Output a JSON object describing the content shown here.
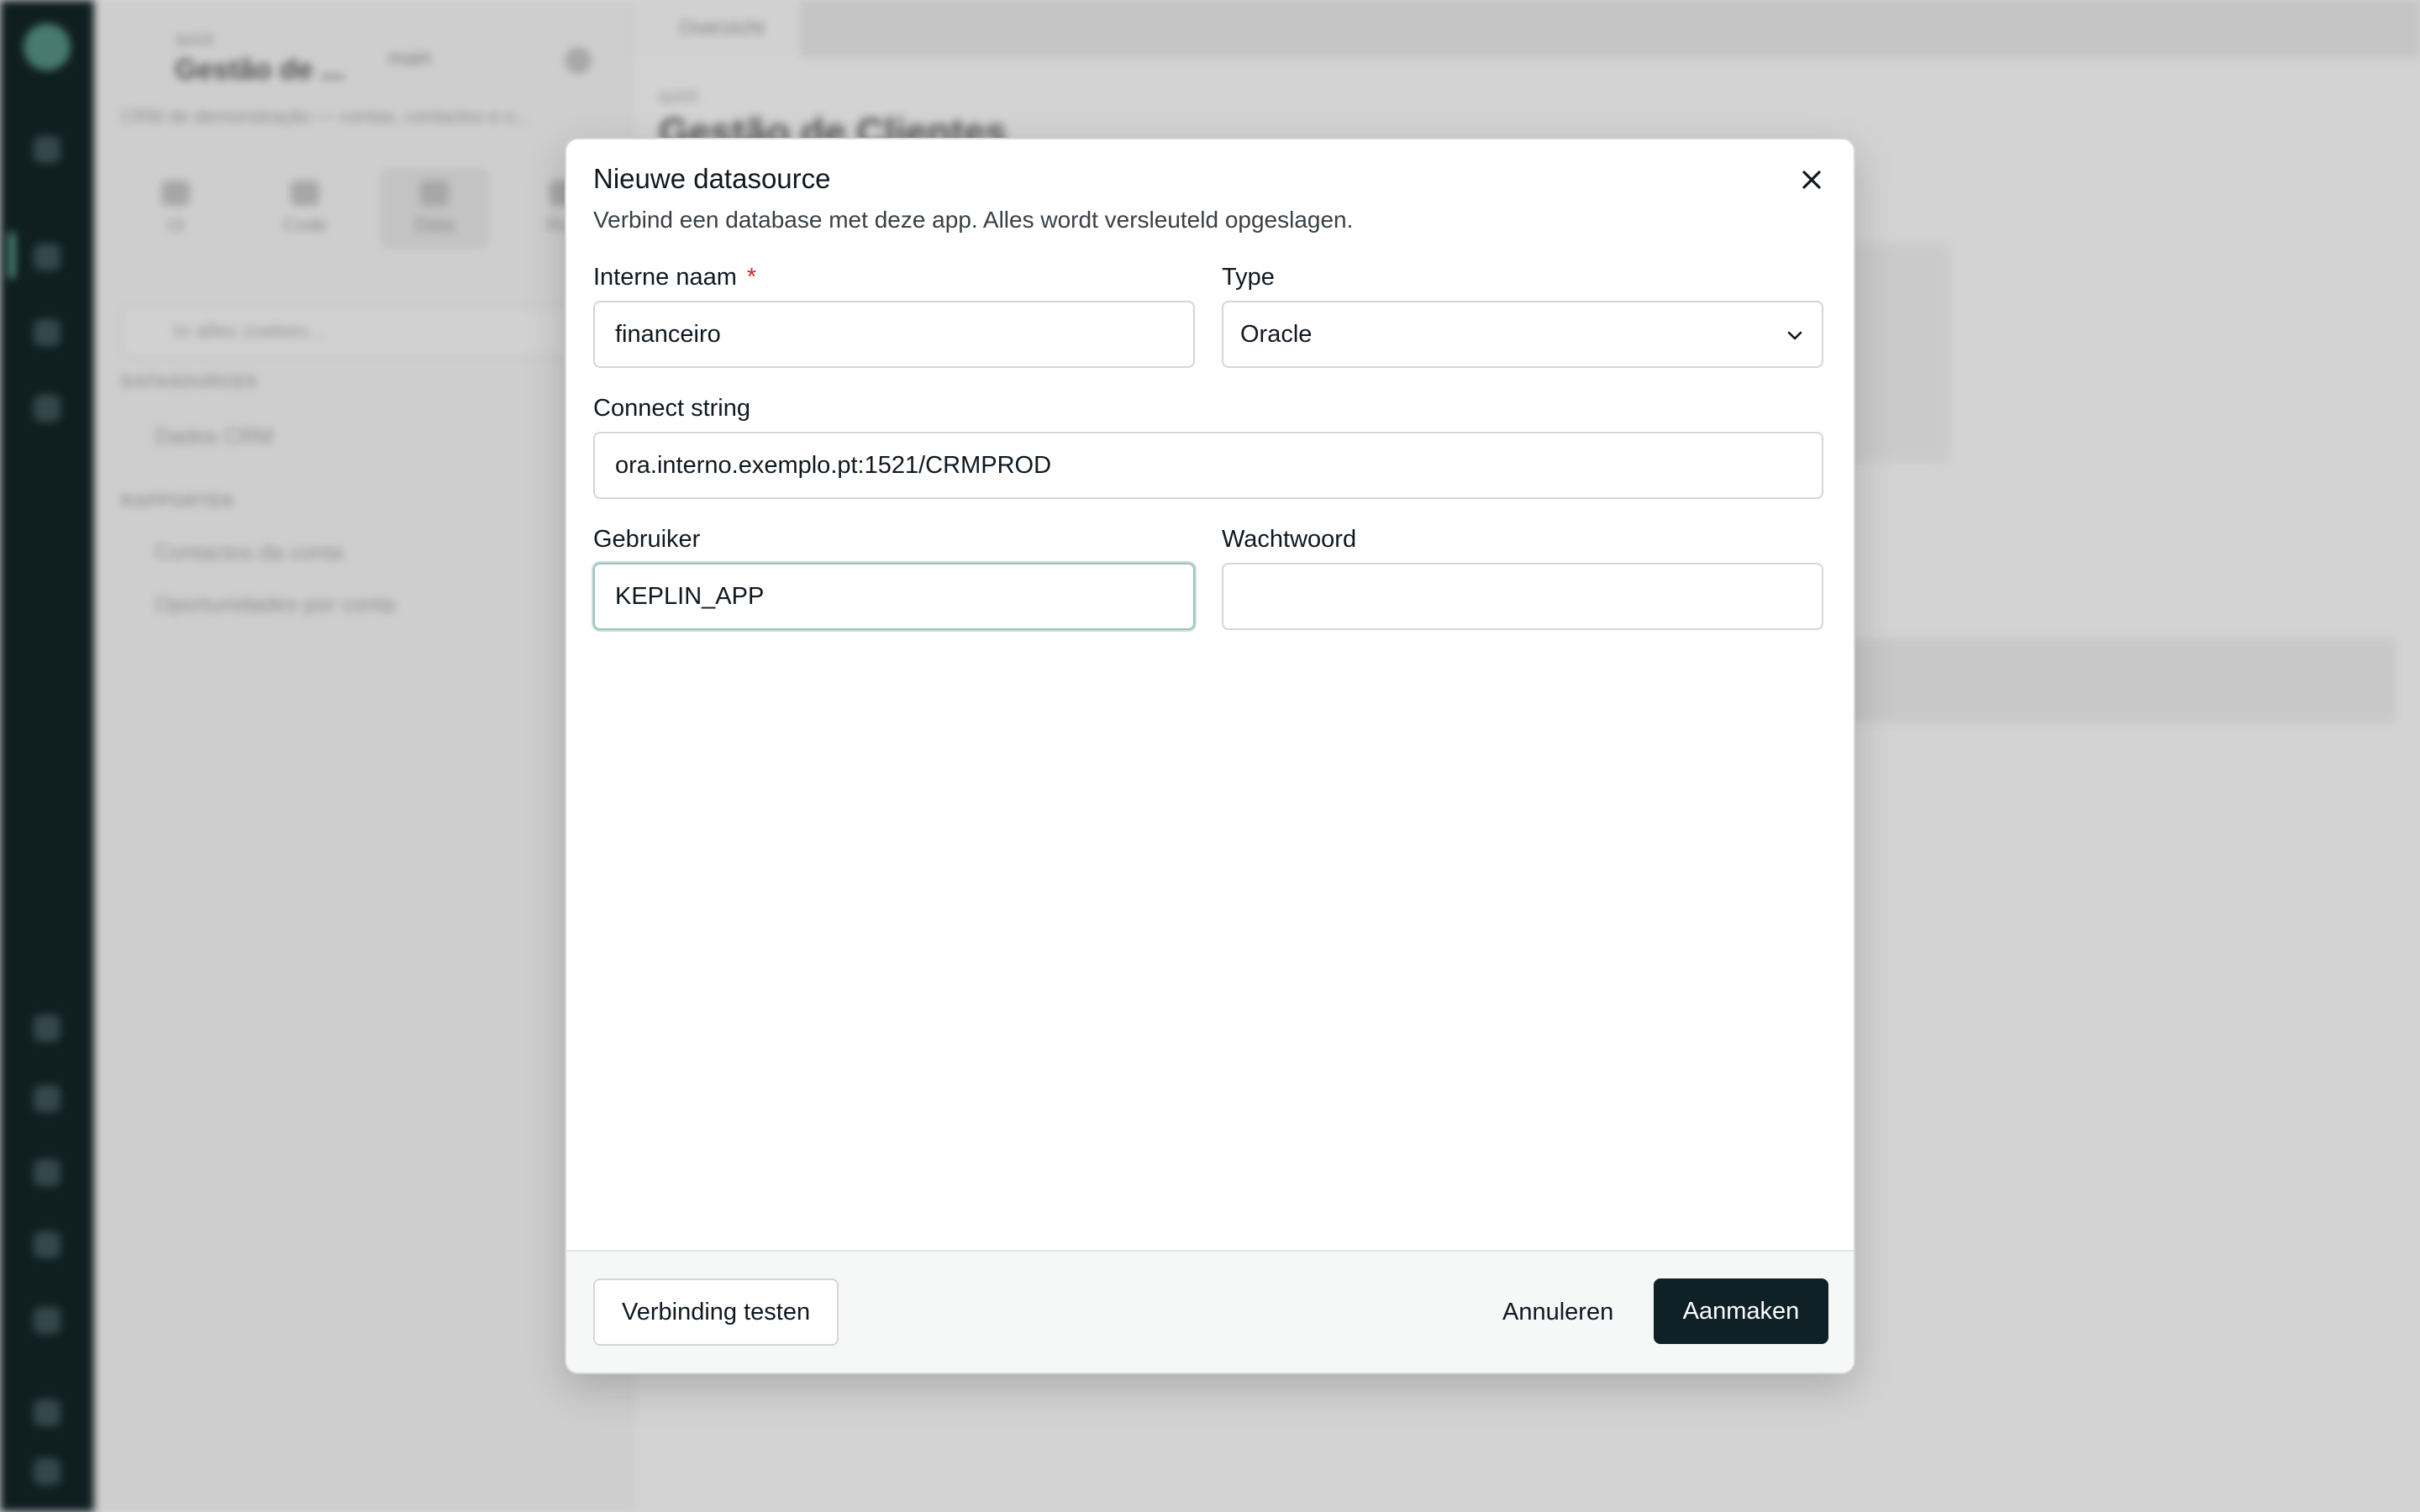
{
  "background": {
    "workspace_label": "quick",
    "app_name": "Gestão de ...",
    "branch_label": "main",
    "app_description": "CRM de demonstração — contas, contactos e o...",
    "sidebar_tabs": [
      {
        "label": "UI"
      },
      {
        "label": "Code"
      },
      {
        "label": "Data"
      },
      {
        "label": "Run"
      }
    ],
    "search_placeholder": "In alles zoeken...",
    "datasources_heading": "DATASOURCES",
    "datasource_items": [
      "Dados CRM"
    ],
    "queries_heading": "RAPPORTEN",
    "query_items": [
      "Contactos da conta",
      "Oportunidades por conta"
    ],
    "open_tab": "Overzicht",
    "main_workspace": "quick",
    "main_title": "Gestão de Clientes"
  },
  "modal": {
    "title": "Nieuwe datasource",
    "description": "Verbind een database met deze app. Alles wordt versleuteld opgeslagen.",
    "fields": {
      "internal_name": {
        "label": "Interne naam",
        "required_mark": "*",
        "value": "financeiro"
      },
      "type": {
        "label": "Type",
        "selected": "Oracle"
      },
      "connect_string": {
        "label": "Connect string",
        "value": "ora.interno.exemplo.pt:1521/CRMPROD"
      },
      "user": {
        "label": "Gebruiker",
        "value": "KEPLIN_APP"
      },
      "password": {
        "label": "Wachtwoord",
        "value": ""
      }
    },
    "buttons": {
      "test": "Verbinding testen",
      "cancel": "Annuleren",
      "create": "Aanmaken"
    }
  },
  "colors": {
    "primary": "#0f2027",
    "required": "#d42020",
    "focus_ring": "#9cc3bc",
    "rail": "#0f2024"
  }
}
